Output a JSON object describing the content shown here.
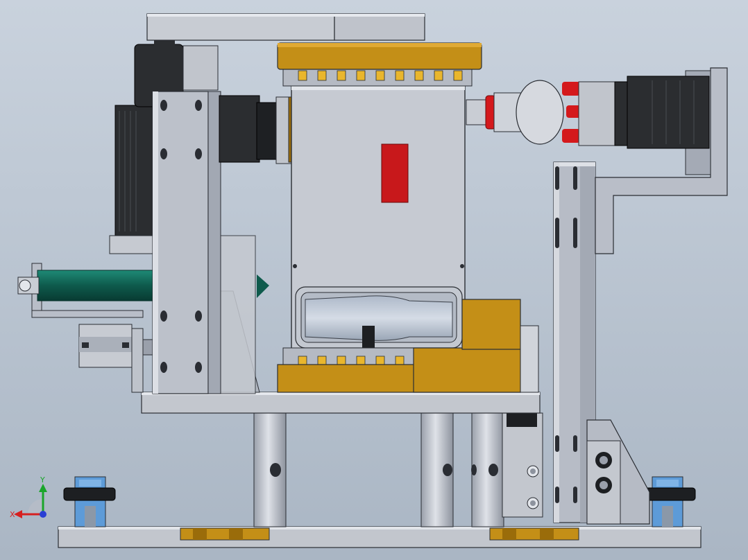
{
  "view": {
    "background_top": "#c9d2dd",
    "background_bottom": "#aab6c4"
  },
  "colors": {
    "steel": "#b9bec8",
    "steel_light": "#d3d7de",
    "steel_dark": "#8c939e",
    "brass": "#c48f17",
    "brass_dark": "#9a6c0a",
    "motor_black": "#2b2d30",
    "teal_cylinder": "#0e5a4c",
    "red_accent": "#d4191c",
    "blue_clamp": "#5d9bd8",
    "edge": "#2a2d33"
  },
  "triad": {
    "x_label": "X",
    "y_label": "Y",
    "x_color": "#d62020",
    "y_color": "#1aa52a",
    "z_color": "#2a3fd4"
  }
}
